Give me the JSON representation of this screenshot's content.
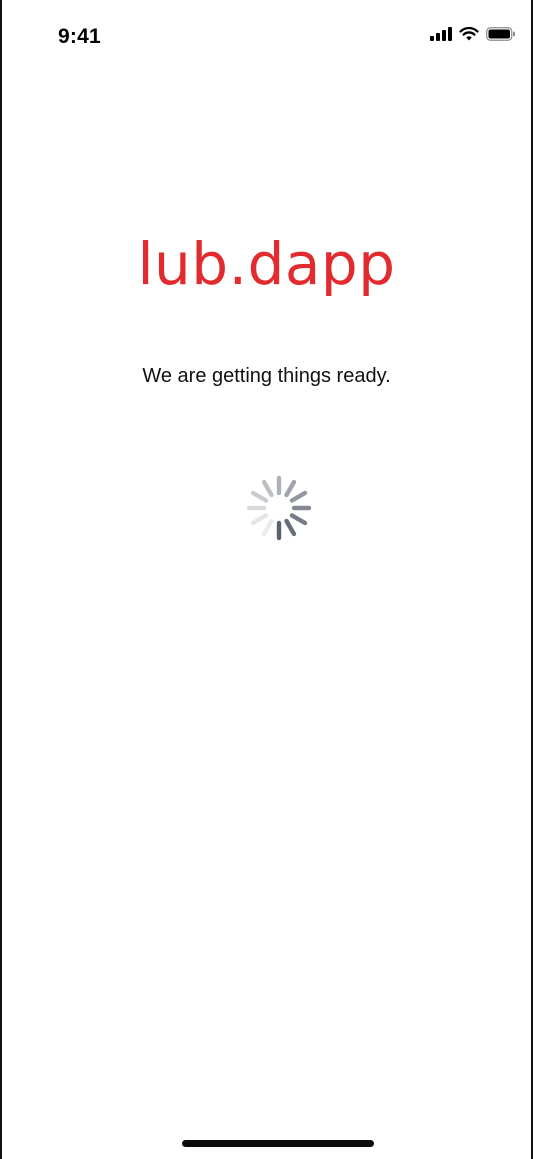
{
  "status_bar": {
    "time": "9:41",
    "signal_icon": "cellular-signal-icon",
    "wifi_icon": "wifi-icon",
    "battery_icon": "battery-icon"
  },
  "splash": {
    "logo_text": "lub.dapp",
    "message": "We are getting things ready.",
    "spinner_icon": "loading-spinner-icon"
  },
  "colors": {
    "brand": "#e12b2f",
    "text": "#111111",
    "background": "#ffffff",
    "spinner_dark": "#5b6170",
    "spinner_light": "#e4e6ea"
  }
}
